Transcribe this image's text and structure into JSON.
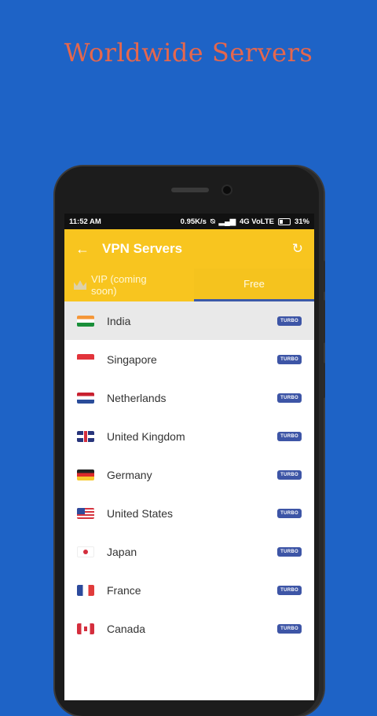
{
  "headline": "Worldwide Servers",
  "status_bar": {
    "time": "11:52 AM",
    "speed": "0.95K/s",
    "network": "4G VoLTE",
    "battery": "31%"
  },
  "app_bar": {
    "back_icon": "arrow-left-icon",
    "title": "VPN Servers",
    "refresh_icon": "refresh-icon"
  },
  "tabs": [
    {
      "label": "VIP (coming soon)",
      "icon": "crown-icon"
    },
    {
      "label": "Free",
      "selected": true
    }
  ],
  "servers": [
    {
      "country": "India",
      "badge": "TURBO",
      "flag": "in"
    },
    {
      "country": "Singapore",
      "badge": "TURBO",
      "flag": "sg"
    },
    {
      "country": "Netherlands",
      "badge": "TURBO",
      "flag": "nl"
    },
    {
      "country": "United Kingdom",
      "badge": "TURBO",
      "flag": "gb"
    },
    {
      "country": "Germany",
      "badge": "TURBO",
      "flag": "de"
    },
    {
      "country": "United States",
      "badge": "TURBO",
      "flag": "us"
    },
    {
      "country": "Japan",
      "badge": "TURBO",
      "flag": "jp"
    },
    {
      "country": "France",
      "badge": "TURBO",
      "flag": "fr"
    },
    {
      "country": "Canada",
      "badge": "TURBO",
      "flag": "ca"
    }
  ],
  "colors": {
    "background": "#1e63c6",
    "headline": "#e5674d",
    "accent_yellow": "#f8c51f",
    "badge_blue": "#3d55a6"
  }
}
